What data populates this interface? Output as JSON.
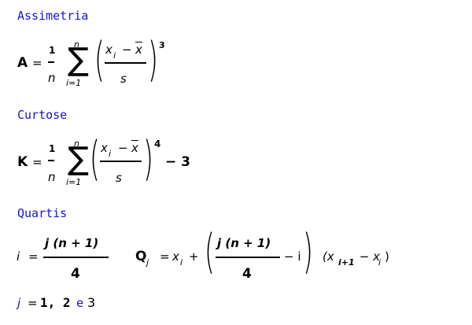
{
  "headings": {
    "skewness": "Assimetria",
    "kurtosis": "Curtose",
    "quartiles": "Quartis"
  },
  "skewness": {
    "lhs": "A",
    "eq": "=",
    "one": "1",
    "n": "n",
    "sum": "∑",
    "upper": "n",
    "lower": "i=1",
    "lparen": "(",
    "rparen": ")",
    "num_x": "x",
    "num_sub": "i",
    "minus": "−",
    "xbar": "x",
    "den": "s",
    "exp": "3"
  },
  "kurtosis": {
    "lhs": "K",
    "eq": "=",
    "one": "1",
    "n": "n",
    "sum": "∑",
    "upper": "n",
    "lower": "i=1",
    "lparen": "(",
    "rparen": ")",
    "num_x": "x",
    "num_sub": "i",
    "minus": "−",
    "xbar": "x",
    "den": "s",
    "exp": "4",
    "tail": "− 3"
  },
  "quartile_index": {
    "lhs": "i",
    "eq": "=",
    "num": "j (n + 1)",
    "den": "4"
  },
  "quartile_value": {
    "lhs": "Q",
    "lhs_sub": "j",
    "eq": "=",
    "x": "x",
    "x_sub": "i",
    "plus": "+",
    "lparen": "(",
    "num": "j (n + 1)",
    "den": "4",
    "minus_i": "− i",
    "rparen": ")",
    "diff_open": "(x",
    "diff_sub1": "i+1",
    "diff_mid": " − x",
    "diff_sub2": "i",
    "diff_close": ")"
  },
  "quartile_range": {
    "var": "j",
    "eq": "=",
    "values": "1, 2",
    "and": "e",
    "last": "3"
  }
}
